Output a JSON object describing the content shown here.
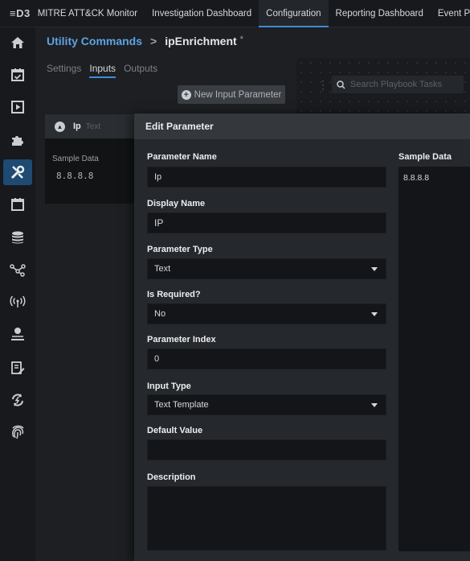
{
  "topnav": {
    "logo": "≡D3",
    "tabs": [
      {
        "label": "MITRE ATT&CK Monitor",
        "active": false
      },
      {
        "label": "Investigation Dashboard",
        "active": false
      },
      {
        "label": "Configuration",
        "active": true
      },
      {
        "label": "Reporting Dashboard",
        "active": false
      },
      {
        "label": "Event Play",
        "active": false
      }
    ]
  },
  "sidebar": {
    "items": [
      {
        "icon": "home-icon",
        "active": false
      },
      {
        "icon": "calendar-check-icon",
        "active": false
      },
      {
        "icon": "play-square-icon",
        "active": false
      },
      {
        "icon": "puzzle-icon",
        "active": false
      },
      {
        "icon": "tools-icon",
        "active": true
      },
      {
        "icon": "calendar-icon",
        "active": false
      },
      {
        "icon": "database-icon",
        "active": false
      },
      {
        "icon": "share-nodes-icon",
        "active": false
      },
      {
        "icon": "broadcast-icon",
        "active": false
      },
      {
        "icon": "user-settings-icon",
        "active": false
      },
      {
        "icon": "document-edit-icon",
        "active": false
      },
      {
        "icon": "sync-bolt-icon",
        "active": false
      },
      {
        "icon": "fingerprint-icon",
        "active": false
      }
    ]
  },
  "breadcrumb": {
    "parent": "Utility Commands",
    "separator": ">",
    "current": "ipEnrichment",
    "modified_marker": "*"
  },
  "subtabs": [
    {
      "label": "Settings",
      "active": false
    },
    {
      "label": "Inputs",
      "active": true
    },
    {
      "label": "Outputs",
      "active": false
    }
  ],
  "new_param_button": "New Input Parameter",
  "canvas": {
    "search_placeholder": "Search Playbook Tasks"
  },
  "param_card": {
    "name": "Ip",
    "type": "Text",
    "sample_label": "Sample Data",
    "sample_value": "8.8.8.8"
  },
  "modal": {
    "title": "Edit Parameter",
    "fields": {
      "param_name": {
        "label": "Parameter Name",
        "value": "Ip"
      },
      "display_name": {
        "label": "Display Name",
        "value": "IP"
      },
      "param_type": {
        "label": "Parameter Type",
        "value": "Text"
      },
      "is_required": {
        "label": "Is Required?",
        "value": "No"
      },
      "param_index": {
        "label": "Parameter Index",
        "value": "0"
      },
      "input_type": {
        "label": "Input Type",
        "value": "Text Template"
      },
      "default_value": {
        "label": "Default Value",
        "value": ""
      },
      "description": {
        "label": "Description",
        "value": ""
      }
    },
    "sample_data": {
      "label": "Sample Data",
      "value": "8.8.8.8"
    }
  }
}
